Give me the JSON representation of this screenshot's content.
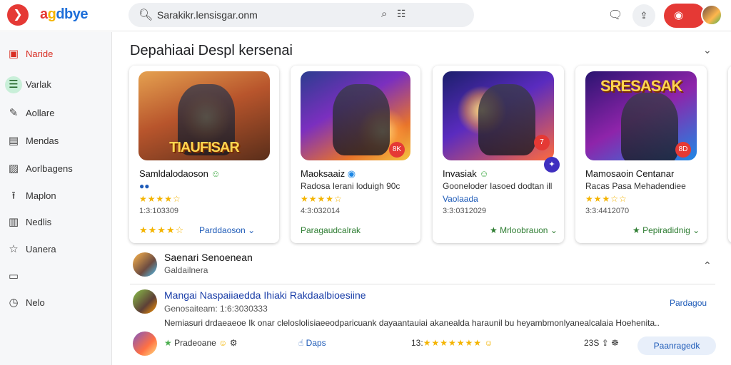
{
  "header": {
    "brand": [
      "a",
      "g",
      "dbye"
    ],
    "search_text": "Sarakikr.lensisgar.onm",
    "icons": [
      "logo-icon",
      "search-icon",
      "mic-icon",
      "chat-icon",
      "share-icon",
      "lock-icon"
    ]
  },
  "sidebar": {
    "items": [
      {
        "label": "Naride",
        "icon": "square-icon"
      },
      {
        "label": "Varlak",
        "icon": "list-icon"
      },
      {
        "label": "Aollare",
        "icon": "pen-icon"
      },
      {
        "label": "Mendas",
        "icon": "doc-icon"
      },
      {
        "label": "Aorlbagens",
        "icon": "image-icon"
      },
      {
        "label": "Maplon",
        "icon": "upload-icon"
      },
      {
        "label": "Nedlis",
        "icon": "note-icon"
      },
      {
        "label": "Uanera",
        "icon": "star-icon"
      },
      {
        "label": "",
        "icon": "folder-icon"
      },
      {
        "label": "Nelo",
        "icon": "clock-icon"
      }
    ]
  },
  "main": {
    "section_title": "Depahiaai Despl kersenai",
    "cards": [
      {
        "art_title": "TIAUFISAR",
        "name": "Samldalodaoson",
        "sub": "●●",
        "stars": "★★★★☆",
        "count": "1:3:103309",
        "action": "Parddaoson",
        "action_stars": "★★★★☆"
      },
      {
        "art_title": "",
        "name": "Maoksaaiz",
        "sub": "Radosa Ierani loduigh 90c",
        "stars": "★★★★☆",
        "count": "4:3:032014",
        "action": "Paragaudcalrak",
        "badge": "8K"
      },
      {
        "art_title": "",
        "name": "Invasiak",
        "sub": "Gooneloder Iasoed dodtan ill",
        "sub2": "Vaolaada",
        "stars": "",
        "count": "3:3:0312029",
        "action": "Mrloobrauon",
        "badge": "7"
      },
      {
        "art_title": "SRESASAK",
        "name": "Mamosaoin Centanar",
        "sub": "Racas Pasa Mehadendiee",
        "stars": "★★★☆☆",
        "count": "3:3:4412070",
        "action": "Pepiradidnig",
        "badge": "8D"
      }
    ],
    "row1": {
      "title": "Saenari Senoenean",
      "sub": "Galdailnera"
    },
    "row2": {
      "title": "Mangai Naspaiiaedda Ihiaki Rakdaalbioesiine",
      "sub": "Genosaiteam:   1:6:3030333",
      "body": "Nemiasuri drdaeaeoe Ik onar cleloslolisiaeeodparicuank dayaantauiai akanealda haraunil bu heyambmonlyanealcalaia Hoehenita..",
      "right": "Pardagou"
    },
    "footer": {
      "item1": "Pradeoane",
      "item2": "Daps",
      "item3": "13:",
      "stars": "★★★★★★★",
      "count": "23S",
      "button": "Paanragedk"
    }
  }
}
